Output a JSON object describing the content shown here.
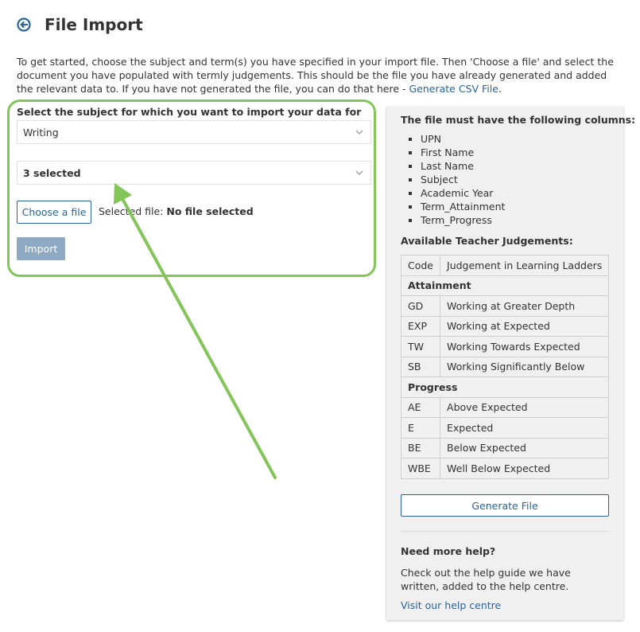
{
  "header": {
    "back_icon": "arrow-circle-left-icon",
    "title": "File Import"
  },
  "intro": {
    "text": "To get started, choose the subject and term(s) you have specified in your import file. Then 'Choose a file' and select the document you have populated with termly judgements. This should be the file you have already generated and added the relevant data to. If you have not generated the file, you can do that here - ",
    "link": "Generate CSV File",
    "tail": "."
  },
  "form": {
    "subject_label": "Select the subject for which you want to import your data for",
    "subject_value": "Writing",
    "term_value": "3 selected",
    "choose_file_label": "Choose a file",
    "selected_file_label": "Selected file: ",
    "selected_file_value": "No file selected",
    "import_label": "Import"
  },
  "panel": {
    "columns_title": "The file must have the following columns:",
    "columns": [
      "UPN",
      "First Name",
      "Last Name",
      "Subject",
      "Academic Year",
      "Term_Attainment",
      "Term_Progress"
    ],
    "judgements_title": "Available Teacher Judgements:",
    "table": {
      "header": {
        "code": "Code",
        "desc": "Judgement in Learning Ladders"
      },
      "attainment_label": "Attainment",
      "attainment": [
        {
          "code": "GD",
          "desc": "Working at Greater Depth"
        },
        {
          "code": "EXP",
          "desc": "Working at Expected"
        },
        {
          "code": "TW",
          "desc": "Working Towards Expected"
        },
        {
          "code": "SB",
          "desc": "Working Significantly Below"
        }
      ],
      "progress_label": "Progress",
      "progress": [
        {
          "code": "AE",
          "desc": "Above Expected"
        },
        {
          "code": "E",
          "desc": "Expected"
        },
        {
          "code": "BE",
          "desc": "Below Expected"
        },
        {
          "code": "WBE",
          "desc": "Well Below Expected"
        }
      ]
    },
    "generate_label": "Generate File",
    "help_title": "Need more help?",
    "help_text": "Check out the help guide we have written, added to the help centre.",
    "help_link": "Visit our help centre"
  },
  "colors": {
    "accent": "#2a6496",
    "highlight": "#84c55a",
    "disabled_button": "#8ea9c4",
    "panel_bg": "#f0f0f0"
  }
}
